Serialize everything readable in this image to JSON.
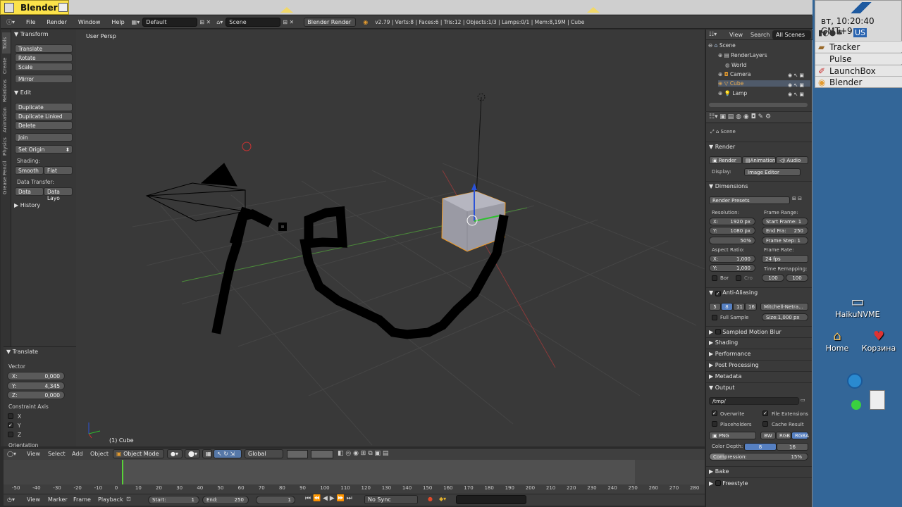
{
  "window": {
    "title": "Blender"
  },
  "menubar": {
    "items": [
      "File",
      "Render",
      "Window",
      "Help"
    ],
    "layout": "Default",
    "scene": "Scene",
    "engine": "Blender Render",
    "stats": "v2.79 | Verts:8 | Faces:6 | Tris:12 | Objects:1/3 | Lamps:0/1 | Mem:8,19M | Cube"
  },
  "tool_tabs": [
    "Tools",
    "Create",
    "Relations",
    "Animation",
    "Physics",
    "Grease Pencil"
  ],
  "tools": {
    "transform_header": "Transform",
    "transform_buttons": [
      "Translate",
      "Rotate",
      "Scale"
    ],
    "mirror": "Mirror",
    "edit_header": "Edit",
    "edit_buttons": [
      "Duplicate",
      "Duplicate Linked",
      "Delete"
    ],
    "join": "Join",
    "set_origin": "Set Origin",
    "shading_label": "Shading:",
    "smooth": "Smooth",
    "flat": "Flat",
    "data_transfer_label": "Data Transfer:",
    "data": "Data",
    "data_layout": "Data Layo",
    "history": "History"
  },
  "operator": {
    "header": "Translate",
    "vector_label": "Vector",
    "x": "X:",
    "x_val": "0,000",
    "y": "Y:",
    "y_val": "4,345",
    "z": "Z:",
    "z_val": "0,000",
    "constraint_label": "Constraint Axis",
    "axes": [
      "X",
      "Y",
      "Z"
    ],
    "orientation": "Orientation"
  },
  "viewport": {
    "label": "User Persp",
    "object_label": "(1) Cube"
  },
  "view3d_header": {
    "menus": [
      "View",
      "Select",
      "Add",
      "Object"
    ],
    "mode": "Object Mode",
    "orientation": "Global"
  },
  "timeline": {
    "ticks": [
      "-50",
      "-40",
      "-30",
      "-20",
      "-10",
      "0",
      "10",
      "20",
      "30",
      "40",
      "50",
      "60",
      "70",
      "80",
      "90",
      "100",
      "110",
      "120",
      "130",
      "140",
      "150",
      "160",
      "170",
      "180",
      "190",
      "200",
      "210",
      "220",
      "230",
      "240",
      "250",
      "260",
      "270",
      "280"
    ],
    "current_frame": 1,
    "menus": [
      "View",
      "Marker",
      "Frame",
      "Playback"
    ],
    "start_label": "Start:",
    "start_val": "1",
    "end_label": "End:",
    "end_val": "250",
    "frame_val": "1",
    "sync": "No Sync"
  },
  "outliner": {
    "menus": [
      "View",
      "Search"
    ],
    "scope": "All Scenes",
    "items": [
      "Scene",
      "RenderLayers",
      "World",
      "Camera",
      "Cube",
      "Lamp"
    ]
  },
  "properties": {
    "context": "Scene",
    "render_header": "Render",
    "render_btn": "Render",
    "animation_btn": "Animation",
    "audio_btn": "Audio",
    "display_label": "Display:",
    "display_val": "Image Editor",
    "dimensions": "Dimensions",
    "presets": "Render Presets",
    "resolution": "Resolution:",
    "res_x": "X:",
    "res_x_val": "1920 px",
    "res_y": "Y:",
    "res_y_val": "1080 px",
    "res_pct": "50%",
    "frame_range": "Frame Range:",
    "start_frame": "Start Frame: 1",
    "end_frame": "End Fra:",
    "end_frame_val": "250",
    "frame_step": "Frame Step: 1",
    "aspect": "Aspect Ratio:",
    "aspect_x": "X:",
    "aspect_x_val": "1,000",
    "aspect_y": "Y:",
    "aspect_y_val": "1,000",
    "frame_rate": "Frame Rate:",
    "fps": "24 fps",
    "time_remap": "Time Remapping:",
    "remap_a": "100",
    "remap_b": "100",
    "bor": "Bor",
    "cro": "Cro",
    "aa": "Anti-Aliasing",
    "aa_samples": [
      "5",
      "8",
      "11",
      "16"
    ],
    "aa_filter": "Mitchell-Netra...",
    "full_sample": "Full Sample",
    "aa_size": "Size:1,000 px",
    "sections": [
      "Sampled Motion Blur",
      "Shading",
      "Performance",
      "Post Processing",
      "Metadata",
      "Output"
    ],
    "out_path": "/tmp/",
    "overwrite": "Overwrite",
    "file_ext": "File Extensions",
    "placeholders": "Placeholders",
    "cache_result": "Cache Result",
    "format": "PNG",
    "bw": "BW",
    "rgb": "RGB",
    "rgba": "RGBA",
    "color_depth": "Color Depth:",
    "depth_8": "8",
    "depth_16": "16",
    "compression": "Compression:",
    "compression_val": "15%",
    "bake": "Bake",
    "freestyle": "Freestyle"
  },
  "deskbar": {
    "clock": "вт, 10:20:40 GMT+9",
    "layout": "US",
    "items": [
      "Tracker",
      "Pulse",
      "LaunchBox",
      "Blender"
    ]
  },
  "desktop_icons": [
    "HaikuNVME",
    "Home",
    "Корзина"
  ]
}
